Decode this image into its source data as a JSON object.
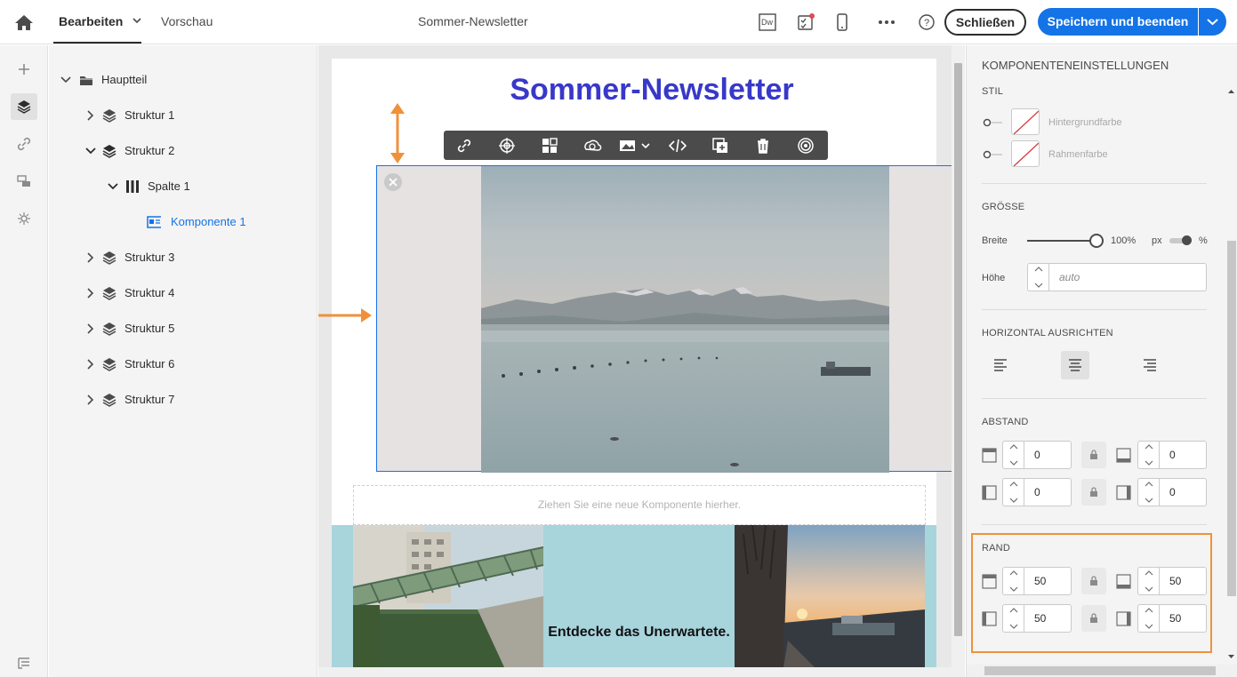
{
  "header": {
    "home_icon": "home-icon",
    "tab_edit": "Bearbeiten",
    "tab_preview": "Vorschau",
    "title": "Sommer-Newsletter",
    "dw_label": "Dw",
    "close_label": "Schließen",
    "save_label": "Speichern und beenden",
    "accent": "#1473e6"
  },
  "rail": {
    "icons": [
      "add-icon",
      "layers-icon",
      "link-icon",
      "fragments-icon",
      "personalization-icon",
      "tree-bottom-icon"
    ]
  },
  "tree": {
    "items": [
      {
        "label": "Hauptteil",
        "icon": "folder-icon",
        "expanded": true
      },
      {
        "label": "Struktur 1",
        "icon": "structure-icon",
        "expanded": false
      },
      {
        "label": "Struktur 2",
        "icon": "structure-icon",
        "expanded": true
      },
      {
        "label": "Spalte 1",
        "icon": "column-icon",
        "expanded": true
      },
      {
        "label": "Komponente 1",
        "icon": "image-component-icon",
        "selected": true
      },
      {
        "label": "Struktur 3",
        "icon": "structure-icon",
        "expanded": false
      },
      {
        "label": "Struktur 4",
        "icon": "structure-icon",
        "expanded": false
      },
      {
        "label": "Struktur 5",
        "icon": "structure-icon",
        "expanded": false
      },
      {
        "label": "Struktur 6",
        "icon": "structure-icon",
        "expanded": false
      },
      {
        "label": "Struktur 7",
        "icon": "structure-icon",
        "expanded": false
      }
    ]
  },
  "canvas": {
    "newsletter_title": "Sommer-Newsletter",
    "title_color": "#3838c9",
    "drop_zone_text": "Ziehen Sie eine neue Komponente hierher.",
    "bottom_text": "Entdecke das Unerwartete.",
    "toolbar_icons": [
      "link-icon",
      "target-icon",
      "layout-icon",
      "creative-cloud-icon",
      "image-icon",
      "code-icon",
      "duplicate-icon",
      "trash-icon",
      "fragment-icon"
    ]
  },
  "settings": {
    "title": "KOMPONENTENEINSTELLUNGEN",
    "style_head": "STIL",
    "bg_color_label": "Hintergrundfarbe",
    "border_color_label": "Rahmenfarbe",
    "size_head": "GRÖSSE",
    "width_label": "Breite",
    "width_value": "100%",
    "unit_px": "px",
    "unit_pct": "%",
    "height_label": "Höhe",
    "height_placeholder": "auto",
    "halign_head": "HORIZONTAL AUSRICHTEN",
    "halign_selected": "center",
    "spacing_head": "ABSTAND",
    "padding": {
      "top": "0",
      "bottom": "0",
      "left": "0",
      "right": "0"
    },
    "margin_head": "RAND",
    "margin": {
      "top": "50",
      "bottom": "50",
      "left": "50",
      "right": "50"
    },
    "highlight_color": "#f0913a"
  }
}
